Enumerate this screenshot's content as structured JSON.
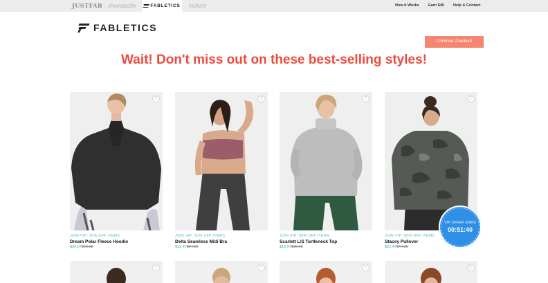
{
  "topbar": {
    "brands": [
      "JUSTFAB",
      "shoedazzle",
      "FABLETICS",
      "fabkids"
    ],
    "links": [
      "How it Works",
      "Earn $40",
      "Help & Contact"
    ]
  },
  "header": {
    "logo_text": "FABLETICS",
    "cta_label": "Continue Checkout"
  },
  "headline": "Wait! Don't miss out on these best-selling styles!",
  "products": [
    {
      "promo": "JOIN VIP: 50% OFF ITEMS",
      "name": "Dream Polar Fleece Hoodie",
      "vip_price": "$34.97",
      "orig_price": "$69.95"
    },
    {
      "promo": "JOIN VIP: 50% OFF ITEMS",
      "name": "Delta Seamless Midi Bra",
      "vip_price": "$12.47",
      "orig_price": "$24.95"
    },
    {
      "promo": "JOIN VIP: 50% OFF ITEMS",
      "name": "Scarlett L/S Turtleneck Top",
      "vip_price": "$19.97",
      "orig_price": "$39.95"
    },
    {
      "promo": "JOIN VIP: 50% OFF ITEMS",
      "name": "Stacey Pullover",
      "vip_price": "$22.47",
      "orig_price": "$44.95"
    }
  ],
  "timer": {
    "label": "VIP OFFER ENDS",
    "value": "00:51:40"
  },
  "colors": {
    "accent": "#ee4a3b",
    "cta": "#f4856e",
    "promo": "#57b9c1",
    "timer": "#2f8fe6"
  }
}
